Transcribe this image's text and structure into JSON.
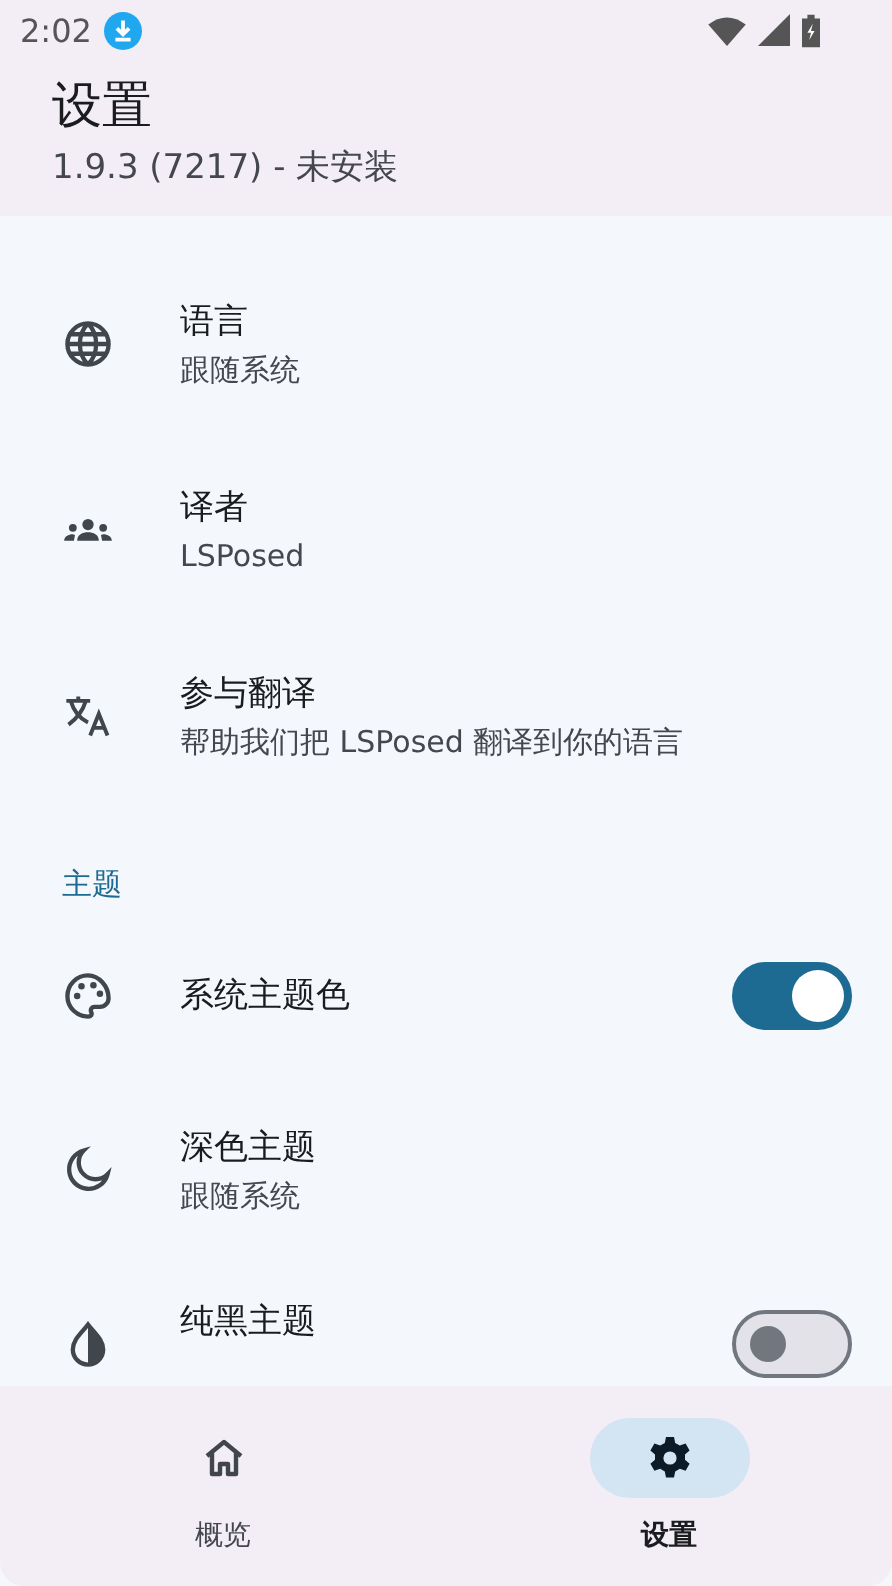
{
  "status_bar": {
    "time": "2:02"
  },
  "app_bar": {
    "title": "设置",
    "subtitle": "1.9.3 (7217) - 未安装"
  },
  "sections": [
    {
      "items": [
        {
          "kind": "plain",
          "title": "语言",
          "summary": "跟随系统"
        },
        {
          "kind": "plain",
          "title": "译者",
          "summary": "LSPosed"
        },
        {
          "kind": "plain",
          "title": "参与翻译",
          "summary": "帮助我们把 LSPosed 翻译到你的语言"
        }
      ]
    },
    {
      "header": "主题",
      "items": [
        {
          "kind": "switch",
          "title": "系统主题色",
          "on": true
        },
        {
          "kind": "plain",
          "title": "深色主题",
          "summary": "跟随系统"
        },
        {
          "kind": "switch",
          "title": "纯黑主题",
          "on": false
        }
      ]
    }
  ],
  "nav": [
    {
      "label": "概览",
      "selected": false
    },
    {
      "label": "设置",
      "selected": true
    }
  ]
}
